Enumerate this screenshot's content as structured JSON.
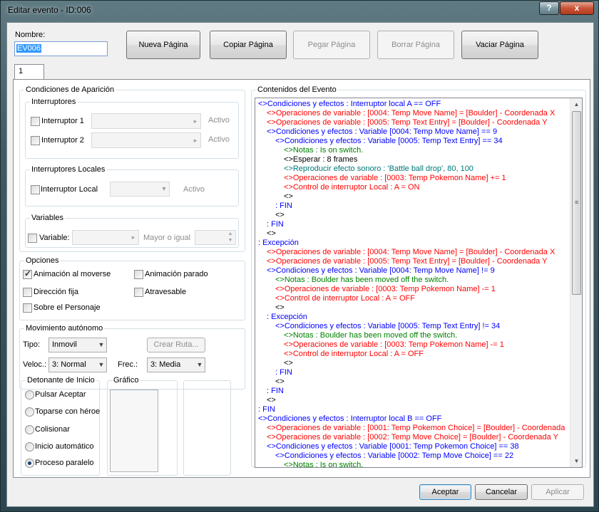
{
  "window": {
    "title": "Editar evento - ID:006",
    "help": "?",
    "close": "x"
  },
  "nombre": {
    "label": "Nombre:",
    "value": "EV006"
  },
  "toolbar": {
    "nueva": "Nueva Página",
    "copiar": "Copiar Página",
    "pegar": "Pegar Página",
    "borrar": "Borrar Página",
    "vaciar": "Vaciar Página"
  },
  "tab": {
    "label": "1"
  },
  "condiciones": {
    "title": "Condiciones de Aparición",
    "interruptores": {
      "title": "Interruptores",
      "sw1": "Interruptor 1",
      "sw2": "Interruptor 2",
      "activo": "Activo"
    },
    "locales": {
      "title": "Interruptores Locales",
      "label": "Interruptor Local",
      "activo": "Activo"
    },
    "variables": {
      "title": "Variables",
      "label": "Variable:",
      "mayor": "Mayor o igual"
    }
  },
  "opciones": {
    "title": "Opciones",
    "anim_mov": "Animación al moverse",
    "anim_parado": "Animación parado",
    "dir_fija": "Dirección fija",
    "atravesable": "Atravesable",
    "sobre": "Sobre el Personaje"
  },
  "movimiento": {
    "title": "Movimiento autónomo",
    "tipo_label": "Tipo:",
    "tipo_value": "Inmovil",
    "crear_ruta": "Crear Ruta...",
    "veloc_label": "Veloc.:",
    "veloc_value": "3: Normal",
    "frec_label": "Frec.:",
    "frec_value": "3: Media"
  },
  "detonante": {
    "title": "Detonante de Inicio",
    "options": [
      "Pulsar Aceptar",
      "Toparse con héroe",
      "Colisionar",
      "Inicio automático",
      "Proceso paralelo"
    ],
    "selected": "Proceso paralelo"
  },
  "grafico": {
    "title": "Gráfico"
  },
  "contenidos": {
    "title": "Contenidos del Evento",
    "lines": [
      {
        "text": "<>Condiciones y efectos : Interruptor local A == OFF",
        "color": "blue",
        "indent": 0
      },
      {
        "text": "<>Operaciones de variable : [0004: Temp Move Name] = [Boulder] - Coordenada X",
        "color": "red",
        "indent": 1
      },
      {
        "text": "<>Operaciones de variable : [0005: Temp Text Entry] = [Boulder] - Coordenada Y",
        "color": "red",
        "indent": 1
      },
      {
        "text": "<>Condiciones y efectos : Variable [0004: Temp Move Name] == 9",
        "color": "blue",
        "indent": 1
      },
      {
        "text": "<>Condiciones y efectos : Variable [0005: Temp Text Entry] == 34",
        "color": "blue",
        "indent": 2
      },
      {
        "text": "<>Notas : Is on switch.",
        "color": "green",
        "indent": 3
      },
      {
        "text": "<>Esperar : 8 frames",
        "color": "black",
        "indent": 3
      },
      {
        "text": "<>Reproducir efecto sonoro : 'Battle ball drop', 80, 100",
        "color": "teal",
        "indent": 3
      },
      {
        "text": "<>Operaciones de variable : [0003: Temp Pokemon Name] += 1",
        "color": "red",
        "indent": 3
      },
      {
        "text": "<>Control de interruptor Local : A = ON",
        "color": "red",
        "indent": 3
      },
      {
        "text": "<>",
        "color": "black",
        "indent": 3
      },
      {
        "text": ":  FIN",
        "color": "blue",
        "indent": 2
      },
      {
        "text": "<>",
        "color": "black",
        "indent": 2
      },
      {
        "text": ":  FIN",
        "color": "blue",
        "indent": 1
      },
      {
        "text": "<>",
        "color": "black",
        "indent": 1
      },
      {
        "text": ":  Excepción",
        "color": "blue",
        "indent": 0
      },
      {
        "text": "<>Operaciones de variable : [0004: Temp Move Name] = [Boulder] - Coordenada X",
        "color": "red",
        "indent": 1
      },
      {
        "text": "<>Operaciones de variable : [0005: Temp Text Entry] = [Boulder] - Coordenada Y",
        "color": "red",
        "indent": 1
      },
      {
        "text": "<>Condiciones y efectos : Variable [0004: Temp Move Name] != 9",
        "color": "blue",
        "indent": 1
      },
      {
        "text": "<>Notas : Boulder has been moved off the switch.",
        "color": "green",
        "indent": 2
      },
      {
        "text": "<>Operaciones de variable : [0003: Temp Pokemon Name] -= 1",
        "color": "red",
        "indent": 2
      },
      {
        "text": "<>Control de interruptor Local : A = OFF",
        "color": "red",
        "indent": 2
      },
      {
        "text": "<>",
        "color": "black",
        "indent": 2
      },
      {
        "text": ":  Excepción",
        "color": "blue",
        "indent": 1
      },
      {
        "text": "<>Condiciones y efectos : Variable [0005: Temp Text Entry] != 34",
        "color": "blue",
        "indent": 2
      },
      {
        "text": "<>Notas : Boulder has been moved off the switch.",
        "color": "green",
        "indent": 3
      },
      {
        "text": "<>Operaciones de variable : [0003: Temp Pokemon Name] -= 1",
        "color": "red",
        "indent": 3
      },
      {
        "text": "<>Control de interruptor Local : A = OFF",
        "color": "red",
        "indent": 3
      },
      {
        "text": "<>",
        "color": "black",
        "indent": 3
      },
      {
        "text": ":  FIN",
        "color": "blue",
        "indent": 2
      },
      {
        "text": "<>",
        "color": "black",
        "indent": 2
      },
      {
        "text": ":  FIN",
        "color": "blue",
        "indent": 1
      },
      {
        "text": "<>",
        "color": "black",
        "indent": 1
      },
      {
        "text": ":  FIN",
        "color": "blue",
        "indent": 0
      },
      {
        "text": "<>Condiciones y efectos : Interruptor local B == OFF",
        "color": "blue",
        "indent": 0
      },
      {
        "text": "<>Operaciones de variable : [0001: Temp Pokemon Choice] = [Boulder] - Coordenada",
        "color": "red",
        "indent": 1
      },
      {
        "text": "<>Operaciones de variable : [0002: Temp Move Choice] = [Boulder] - Coordenada Y",
        "color": "red",
        "indent": 1
      },
      {
        "text": "<>Condiciones y efectos : Variable [0001: Temp Pokemon Choice] == 38",
        "color": "blue",
        "indent": 1
      },
      {
        "text": "<>Condiciones y efectos : Variable [0002: Temp Move Choice] == 22",
        "color": "blue",
        "indent": 2
      },
      {
        "text": "<>Notas : Is on switch.",
        "color": "green",
        "indent": 3
      }
    ]
  },
  "footer": {
    "aceptar": "Aceptar",
    "cancelar": "Cancelar",
    "aplicar": "Aplicar"
  },
  "colors": {
    "blue": "#0000ff",
    "red": "#ff0000",
    "green": "#008000",
    "teal": "#007878",
    "black": "#000000"
  }
}
